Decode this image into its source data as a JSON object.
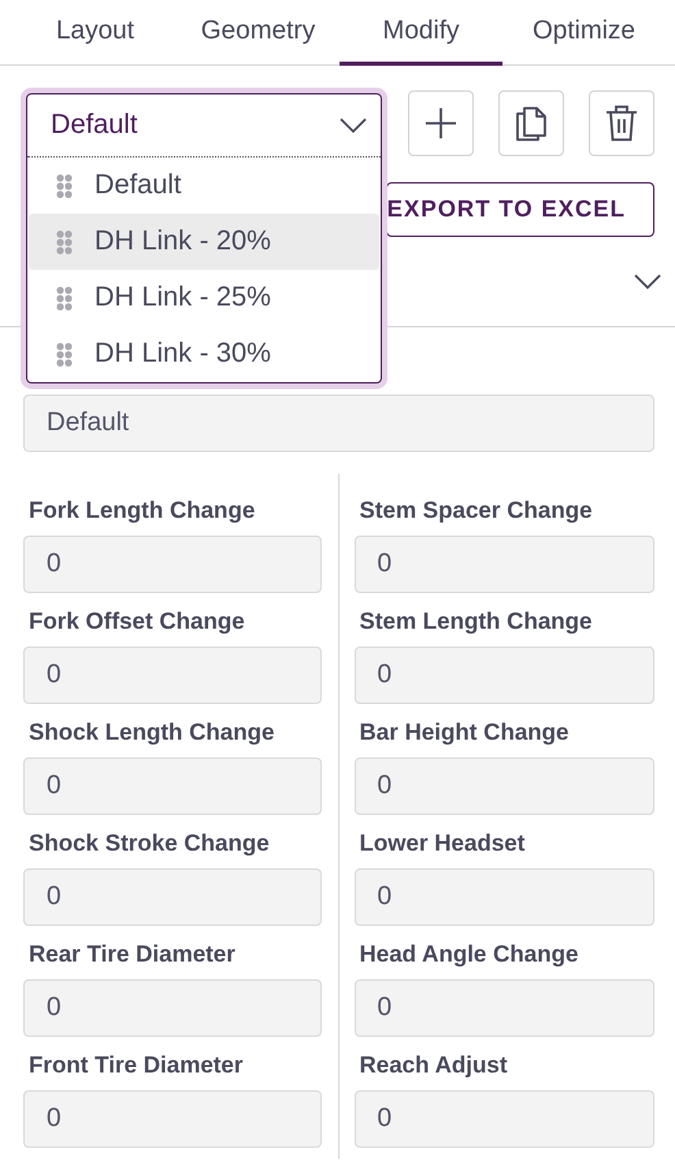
{
  "tabs": [
    {
      "label": "Layout",
      "selected": false
    },
    {
      "label": "Geometry",
      "selected": false
    },
    {
      "label": "Modify",
      "selected": true
    },
    {
      "label": "Optimize",
      "selected": false
    }
  ],
  "preset_select": {
    "value": "Default",
    "expanded": true,
    "options": [
      {
        "label": "Default",
        "highlighted": false
      },
      {
        "label": "DH Link - 20%",
        "highlighted": true
      },
      {
        "label": "DH Link - 25%",
        "highlighted": false
      },
      {
        "label": "DH Link - 30%",
        "highlighted": false
      }
    ]
  },
  "export_button": "EXPORT TO EXCEL",
  "name_field": {
    "value": "Default"
  },
  "left_fields": [
    {
      "label": "Fork Length Change",
      "value": "0"
    },
    {
      "label": "Fork Offset Change",
      "value": "0"
    },
    {
      "label": "Shock Length Change",
      "value": "0"
    },
    {
      "label": "Shock Stroke Change",
      "value": "0"
    },
    {
      "label": "Rear Tire Diameter",
      "value": "0"
    },
    {
      "label": "Front Tire Diameter",
      "value": "0"
    }
  ],
  "right_fields": [
    {
      "label": "Stem Spacer Change",
      "value": "0"
    },
    {
      "label": "Stem Length Change",
      "value": "0"
    },
    {
      "label": "Bar Height Change",
      "value": "0"
    },
    {
      "label": "Lower Headset",
      "value": "0"
    },
    {
      "label": "Head Angle Change",
      "value": "0"
    },
    {
      "label": "Reach Adjust",
      "value": "0"
    }
  ]
}
